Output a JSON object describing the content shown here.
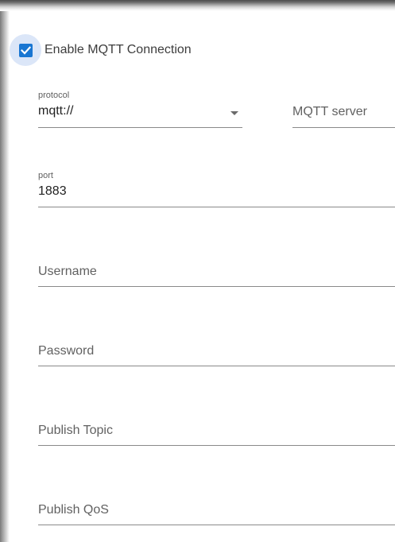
{
  "form": {
    "enable_mqtt": {
      "label": "Enable MQTT Connection",
      "checked": true,
      "accent_color": "#1976d2"
    },
    "protocol": {
      "label": "protocol",
      "value": "mqtt://"
    },
    "server": {
      "placeholder": "MQTT server"
    },
    "port": {
      "label": "port",
      "value": "1883"
    },
    "username": {
      "placeholder": "Username"
    },
    "password": {
      "placeholder": "Password"
    },
    "publish_topic": {
      "placeholder": "Publish Topic"
    },
    "publish_qos": {
      "placeholder": "Publish QoS"
    }
  },
  "icons": {
    "checkbox": "check-icon",
    "dropdown": "caret-down-icon"
  }
}
